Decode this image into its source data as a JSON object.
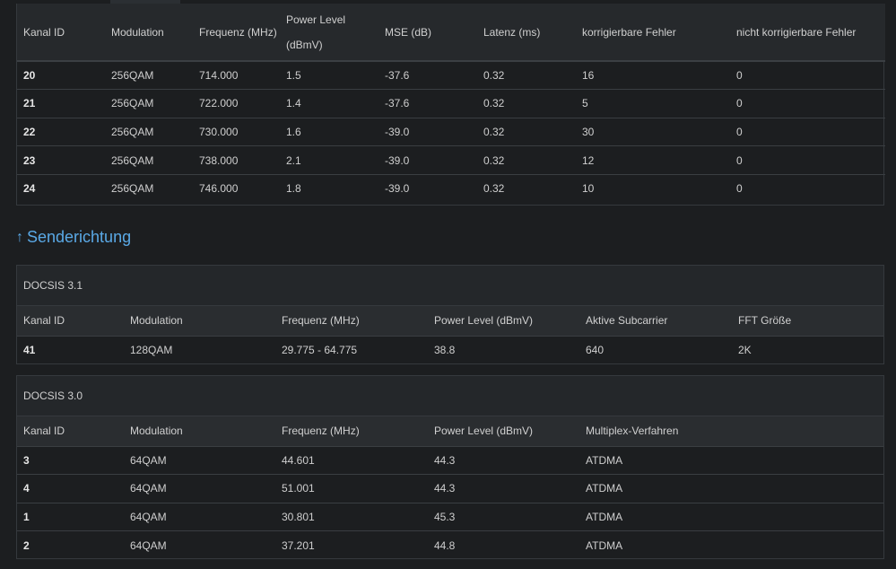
{
  "downstream": {
    "headers": [
      "Kanal ID",
      "Modulation",
      "Frequenz (MHz)",
      "Power Level",
      "(dBmV)",
      "MSE (dB)",
      "Latenz (ms)",
      "korrigierbare Fehler",
      "nicht korrigierbare Fehler"
    ],
    "rows": [
      [
        "20",
        "256QAM",
        "714.000",
        "1.5",
        "-37.6",
        "0.32",
        "16",
        "0"
      ],
      [
        "21",
        "256QAM",
        "722.000",
        "1.4",
        "-37.6",
        "0.32",
        "5",
        "0"
      ],
      [
        "22",
        "256QAM",
        "730.000",
        "1.6",
        "-39.0",
        "0.32",
        "30",
        "0"
      ],
      [
        "23",
        "256QAM",
        "738.000",
        "2.1",
        "-39.0",
        "0.32",
        "12",
        "0"
      ],
      [
        "24",
        "256QAM",
        "746.000",
        "1.8",
        "-39.0",
        "0.32",
        "10",
        "0"
      ]
    ]
  },
  "upstream": {
    "heading": "Senderichtung",
    "heading_icon": "arrow-up-icon",
    "docsis31": {
      "title": "DOCSIS 3.1",
      "headers": [
        "Kanal ID",
        "Modulation",
        "Frequenz (MHz)",
        "Power Level (dBmV)",
        "Aktive Subcarrier",
        "FFT Größe"
      ],
      "rows": [
        [
          "41",
          "128QAM",
          "29.775 - 64.775",
          "38.8",
          "640",
          "2K"
        ]
      ]
    },
    "docsis30": {
      "title": "DOCSIS 3.0",
      "headers": [
        "Kanal ID",
        "Modulation",
        "Frequenz (MHz)",
        "Power Level (dBmV)",
        "Multiplex-Verfahren"
      ],
      "rows": [
        [
          "3",
          "64QAM",
          "44.601",
          "44.3",
          "ATDMA"
        ],
        [
          "4",
          "64QAM",
          "51.001",
          "44.3",
          "ATDMA"
        ],
        [
          "1",
          "64QAM",
          "30.801",
          "45.3",
          "ATDMA"
        ],
        [
          "2",
          "64QAM",
          "37.201",
          "44.8",
          "ATDMA"
        ]
      ]
    }
  },
  "colors": {
    "accent": "#5aa9e6",
    "background": "#1c1e20",
    "header_bg": "#26292c"
  }
}
